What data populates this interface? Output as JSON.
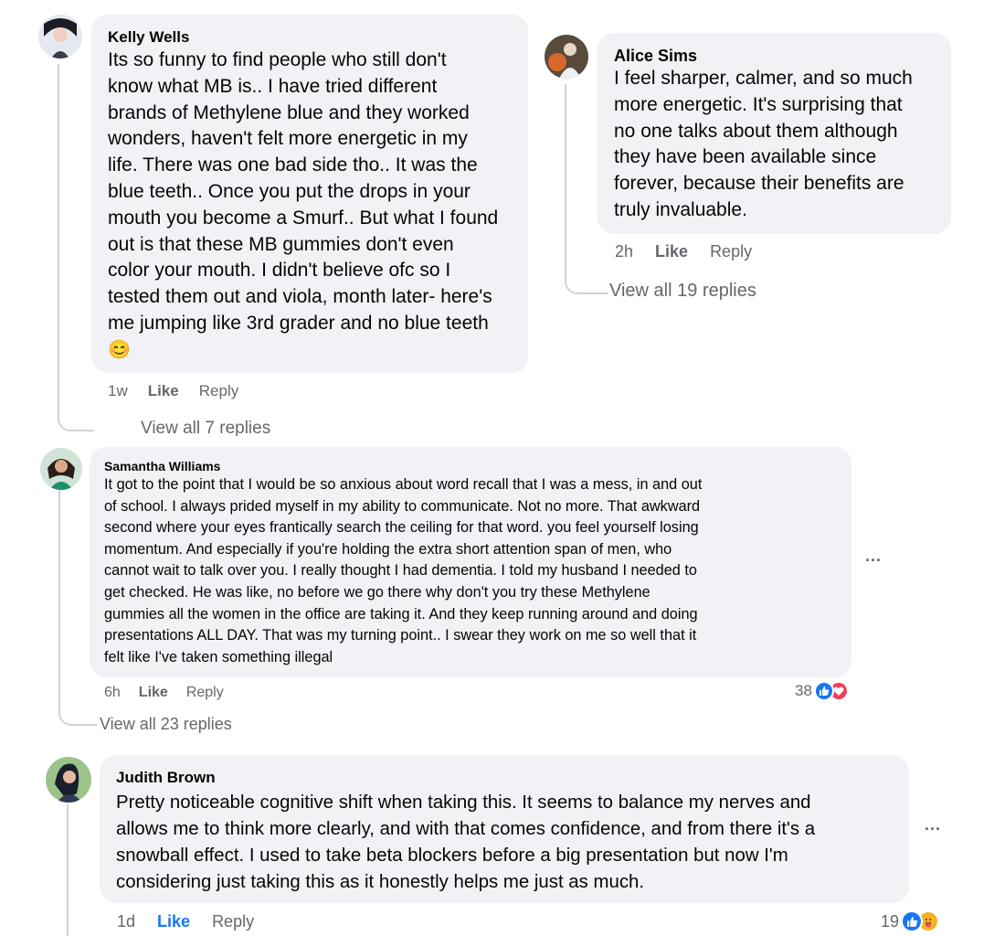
{
  "comments": [
    {
      "name": "Kelly Wells",
      "lines": [
        "Its so funny to find people who still don't",
        "know what MB is.. I have tried different",
        "brands of Methylene blue and they worked",
        "wonders, haven't felt more energetic in my",
        "life. There was one bad side tho.. It was the",
        "blue teeth.. Once you put the drops in your",
        "mouth you become a Smurf.. But what I found",
        "out is that these MB gummies don't even",
        "color your mouth. I didn't believe ofc so I",
        "tested them out and viola, month later- here's",
        "me jumping like 3rd grader and no blue teeth"
      ],
      "emoji": "😊",
      "time": "1w",
      "like": "Like",
      "reply": "Reply",
      "view_replies": "View all 7 replies"
    },
    {
      "name": "Alice Sims",
      "lines": [
        "I feel sharper, calmer, and so much",
        "more energetic. It's surprising that",
        "no one talks about them although",
        "they have been available since",
        "forever, because their benefits are",
        "truly invaluable."
      ],
      "time": "2h",
      "like": "Like",
      "reply": "Reply",
      "view_replies": "View all 19 replies"
    },
    {
      "name": "Samantha Williams",
      "lines": [
        "It got to the point that I would be so anxious about word recall that I was a mess, in and out",
        "of school. I always prided myself in my ability to communicate. Not no more. That awkward",
        "second where your eyes frantically search the ceiling for that word. you feel yourself losing",
        "momentum. And especially if you're holding the extra short attention span of men, who",
        "cannot wait to talk over you. I really thought I had dementia. I told my husband I needed to",
        "get checked. He was like, no before we go there why don't you try these Methylene",
        "gummies all the women in the office are taking it. And they keep running around and doing",
        "presentations ALL DAY. That was my turning point.. I swear they work on me so well that it",
        "felt like I've taken something illegal"
      ],
      "time": "6h",
      "like": "Like",
      "reply": "Reply",
      "reaction_count": "38",
      "view_replies": "View all 23 replies",
      "more": "..."
    },
    {
      "name": "Judith Brown",
      "lines": [
        "Pretty noticeable cognitive shift when taking this. It seems to balance my nerves and",
        "allows me to think more clearly, and with that comes confidence, and from there it's a",
        "snowball effect. I used to take beta blockers before a big presentation but now I'm",
        "considering just taking this as it honestly helps me just as much."
      ],
      "time": "1d",
      "like": "Like",
      "reply": "Reply",
      "reaction_count": "19",
      "more": "..."
    }
  ],
  "icons": {
    "like": "thumbs-up-icon",
    "love": "heart-icon",
    "care": "care-hug-icon"
  },
  "colors": {
    "bubble": "#f0f2f5",
    "meta": "#65676b",
    "like_active": "#1877f2",
    "like_reaction": "#1877f2",
    "love_reaction": "#f33e58",
    "care_reaction": "#f7b125"
  }
}
